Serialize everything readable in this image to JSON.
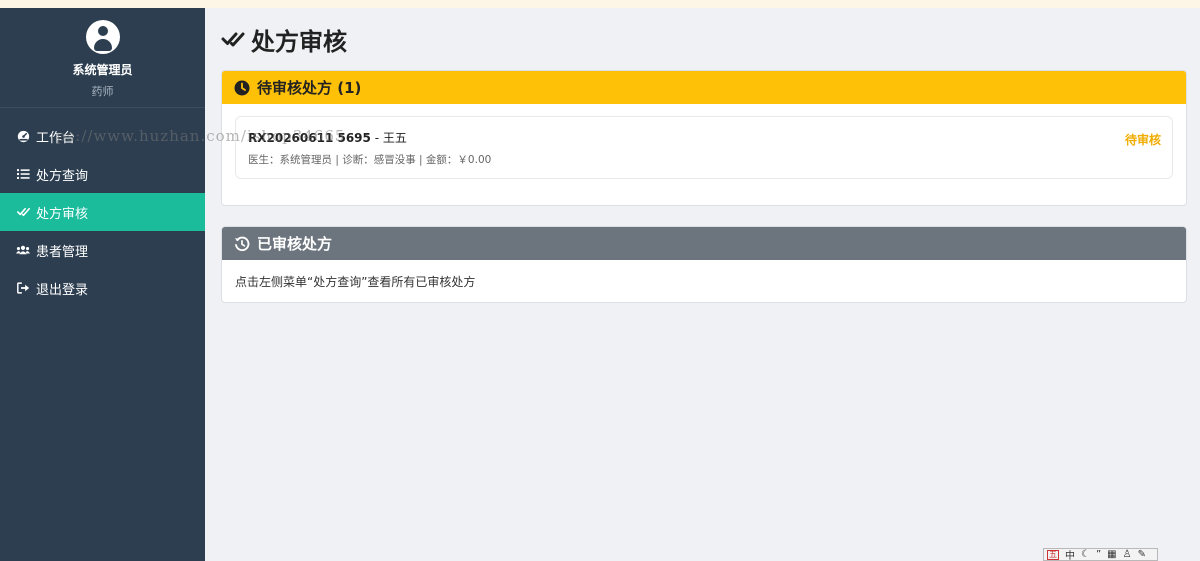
{
  "user": {
    "name": "系统管理员",
    "role": "药师"
  },
  "sidebar": {
    "items": [
      {
        "label": "工作台",
        "icon": "dashboard-icon"
      },
      {
        "label": "处方查询",
        "icon": "list-icon"
      },
      {
        "label": "处方审核",
        "icon": "double-check-icon",
        "active": true
      },
      {
        "label": "患者管理",
        "icon": "users-icon"
      },
      {
        "label": "退出登录",
        "icon": "sign-out-icon"
      }
    ]
  },
  "page": {
    "title": "处方审核",
    "icon": "double-check-icon"
  },
  "pending": {
    "header": "待审核处方 (1)",
    "icon": "clock-icon",
    "items": [
      {
        "rx_id": "RX20260611 5695",
        "patient": " - 王五",
        "meta": "医生：系统管理员 | 诊断：感冒没事 | 金额：￥0.00",
        "status": "待审核"
      }
    ]
  },
  "reviewed": {
    "header": "已审核处方",
    "icon": "history-icon",
    "note": "点击左侧菜单“处方查询”查看所有已审核处方"
  },
  "watermark": "ps://www.huzhan.com/ishop34665",
  "ime": {
    "label": "中",
    "icon": "ime-toolbar-icon"
  },
  "colors": {
    "sidebar": "#2c3e50",
    "active": "#1abc9c",
    "warning": "#ffc107",
    "secondary": "#6c757d"
  }
}
